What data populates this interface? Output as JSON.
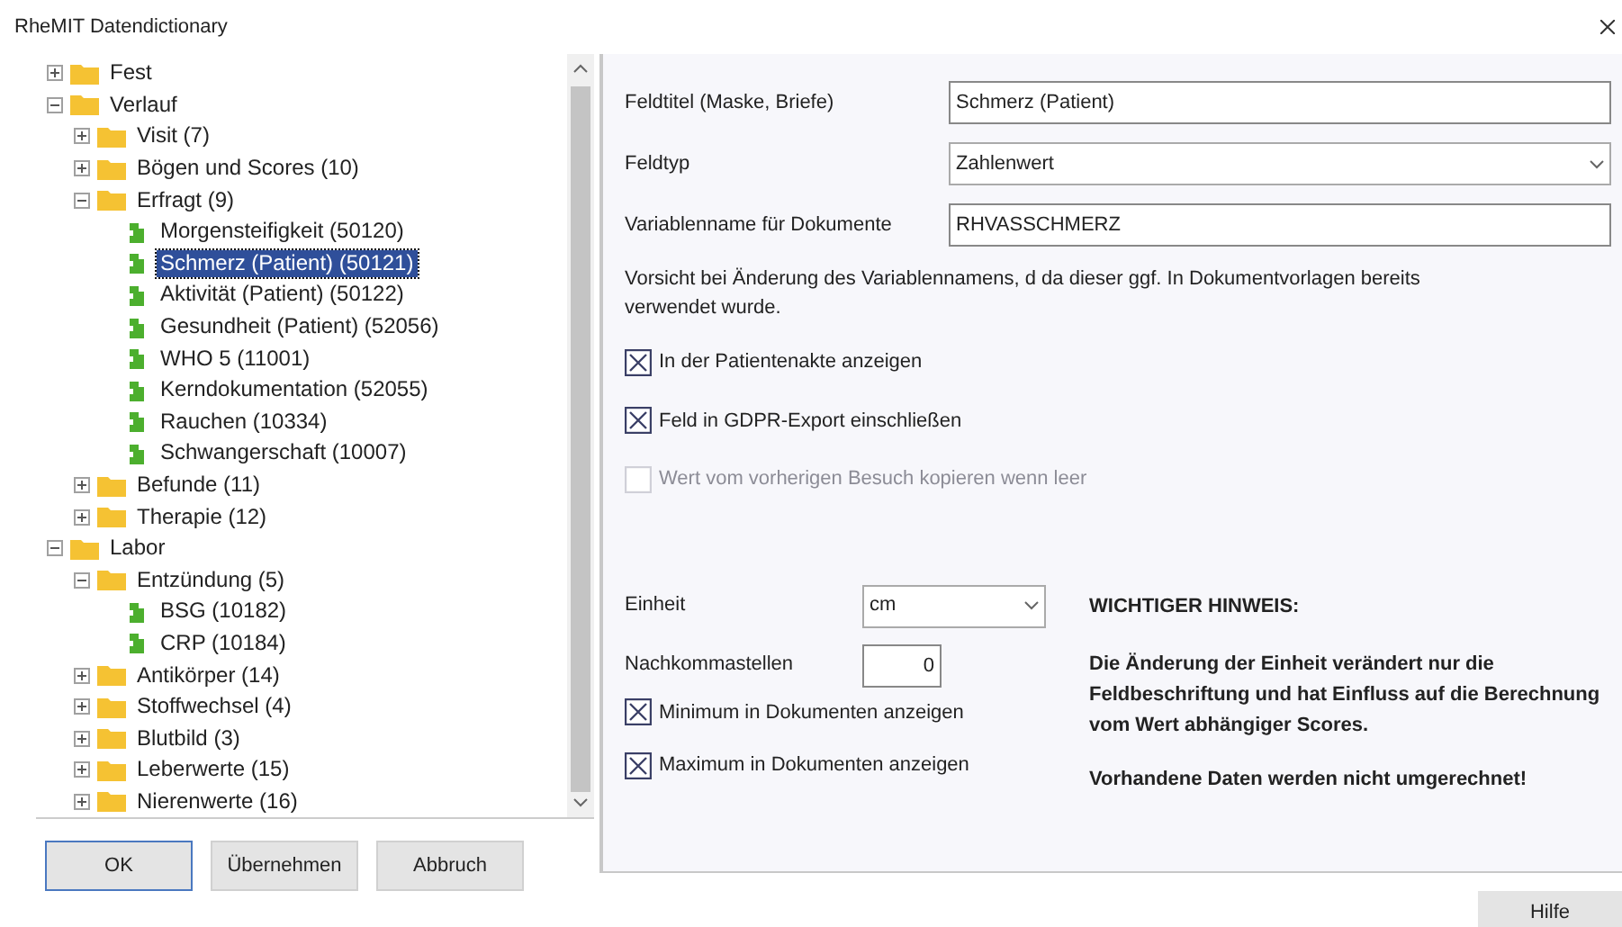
{
  "window": {
    "title": "RheMIT Datendictionary"
  },
  "tree": [
    {
      "label": "Fest",
      "kind": "folder",
      "expanded": false
    },
    {
      "label": "Verlauf",
      "kind": "folder",
      "expanded": true,
      "children": [
        {
          "label": "Visit (7)",
          "kind": "folder",
          "expanded": false
        },
        {
          "label": "Bögen und Scores (10)",
          "kind": "folder",
          "expanded": false
        },
        {
          "label": "Erfragt (9)",
          "kind": "folder",
          "expanded": true,
          "children": [
            {
              "label": "Morgensteifigkeit (50120)",
              "kind": "field",
              "selected": false
            },
            {
              "label": "Schmerz (Patient) (50121)",
              "kind": "field",
              "selected": true
            },
            {
              "label": "Aktivität (Patient) (50122)",
              "kind": "field",
              "selected": false
            },
            {
              "label": "Gesundheit (Patient) (52056)",
              "kind": "field",
              "selected": false
            },
            {
              "label": "WHO 5 (11001)",
              "kind": "field",
              "selected": false
            },
            {
              "label": "Kerndokumentation (52055)",
              "kind": "field",
              "selected": false
            },
            {
              "label": "Rauchen (10334)",
              "kind": "field",
              "selected": false
            },
            {
              "label": "Schwangerschaft (10007)",
              "kind": "field",
              "selected": false
            }
          ]
        },
        {
          "label": "Befunde (11)",
          "kind": "folder",
          "expanded": false
        },
        {
          "label": "Therapie (12)",
          "kind": "folder",
          "expanded": false
        }
      ]
    },
    {
      "label": "Labor",
      "kind": "folder",
      "expanded": true,
      "children": [
        {
          "label": "Entzündung (5)",
          "kind": "folder",
          "expanded": true,
          "children": [
            {
              "label": "BSG (10182)",
              "kind": "field",
              "selected": false
            },
            {
              "label": "CRP (10184)",
              "kind": "field",
              "selected": false
            }
          ]
        },
        {
          "label": "Antikörper (14)",
          "kind": "folder",
          "expanded": false
        },
        {
          "label": "Stoffwechsel (4)",
          "kind": "folder",
          "expanded": false
        },
        {
          "label": "Blutbild (3)",
          "kind": "folder",
          "expanded": false
        },
        {
          "label": "Leberwerte (15)",
          "kind": "folder",
          "expanded": false
        },
        {
          "label": "Nierenwerte (16)",
          "kind": "folder",
          "expanded": false
        }
      ]
    }
  ],
  "form": {
    "fields": [
      {
        "label": "Feldtitel (Maske, Briefe)",
        "kind": "text",
        "value": "Schmerz (Patient)"
      },
      {
        "label": "Feldtyp",
        "kind": "select",
        "value": "Zahlenwert"
      },
      {
        "label": "Variablenname für Dokumente",
        "kind": "text",
        "value": "RHVASSCHMERZ"
      }
    ],
    "warning": "Vorsicht bei Änderung des Variablennamens, d da dieser ggf. In Dokumentvorlagen bereits verwendet wurde.",
    "options": [
      {
        "label": "In der Patientenakte anzeigen",
        "checked": true,
        "disabled": false
      },
      {
        "label": "Feld in GDPR-Export einschließen",
        "checked": true,
        "disabled": false
      },
      {
        "label": "Wert vom vorherigen Besuch kopieren wenn leer",
        "checked": false,
        "disabled": true
      }
    ],
    "unit": {
      "label": "Einheit",
      "value": "cm"
    },
    "decimals": {
      "label": "Nachkommastellen",
      "value": "0"
    },
    "doc_options": [
      {
        "label": "Minimum in Dokumenten anzeigen",
        "checked": true
      },
      {
        "label": "Maximum in Dokumenten anzeigen",
        "checked": true
      }
    ],
    "notice": {
      "title": "WICHTIGER HINWEIS:",
      "text": "Die Änderung der Einheit verändert nur die Feldbeschriftung und hat Einfluss auf die Berechnung vom Wert abhängiger Scores.",
      "note": "Vorhandene Daten werden nicht umgerechnet!"
    }
  },
  "buttons": [
    {
      "label": "OK",
      "kind": "default"
    },
    {
      "label": "Übernehmen",
      "kind": "normal"
    },
    {
      "label": "Abbruch",
      "kind": "normal"
    }
  ],
  "help_button": {
    "label": "Hilfe"
  }
}
